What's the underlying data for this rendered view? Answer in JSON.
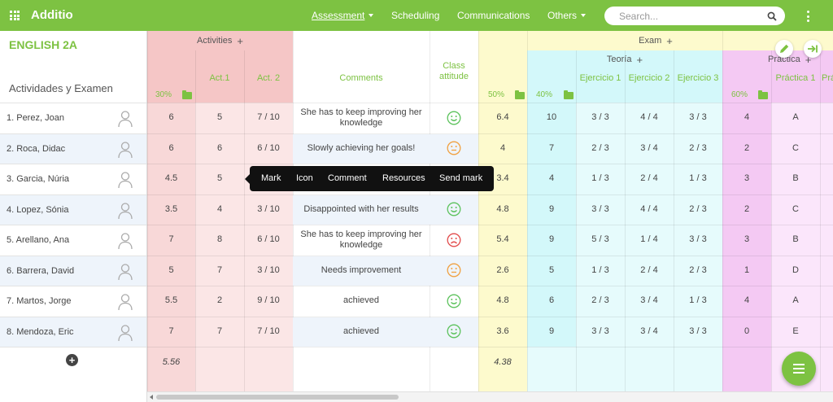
{
  "app": {
    "brand": "Additio"
  },
  "nav": {
    "items": [
      "Assessment",
      "Scheduling",
      "Communications",
      "Others"
    ],
    "search_placeholder": "Search..."
  },
  "colors": {
    "brand": "#7dc242",
    "activities": "#f5c6c6",
    "exam": "#fdfacd",
    "teoria": "#d3f8fa",
    "practica": "#f4c9f3",
    "face_happy": "#5cc25c",
    "face_neutral": "#f0a040",
    "face_sad": "#e24a4a"
  },
  "class": {
    "name": "ENGLISH 2A",
    "left_title": "Actividades y Examen"
  },
  "columns": {
    "activities": {
      "title": "Activities",
      "pct": "30%",
      "act1": "Act.1",
      "act2": "Act. 2"
    },
    "comments": "Comments",
    "attitude": "Class attitude",
    "exam": {
      "title": "Exam",
      "pct": "50%"
    },
    "teoria": {
      "title": "Teoría",
      "pct": "40%",
      "ej1": "Ejercicio 1",
      "ej2": "Ejercicio 2",
      "ej3": "Ejercicio 3"
    },
    "practica": {
      "title": "Práctica",
      "pct": "60%",
      "p1": "Práctica 1",
      "p2": "Prá"
    }
  },
  "students": [
    {
      "name": "1. Perez, Joan",
      "act_avg": "6",
      "act1": "5",
      "act2": "7 / 10",
      "comment": "She has to keep improving her knowledge",
      "face": "happy",
      "exam": "6.4",
      "teoria": "10",
      "ej1": "3 / 3",
      "ej2": "4 / 4",
      "ej3": "3 / 3",
      "practica": "4",
      "p1": "A"
    },
    {
      "name": "2. Roca, Didac",
      "act_avg": "6",
      "act1": "6",
      "act2": "6 / 10",
      "comment": "Slowly achieving her goals!",
      "face": "neutral",
      "exam": "4",
      "teoria": "7",
      "ej1": "2 / 3",
      "ej2": "3 / 4",
      "ej3": "2 / 3",
      "practica": "2",
      "p1": "C"
    },
    {
      "name": "3. Garcia, Núria",
      "act_avg": "4.5",
      "act1": "5",
      "act2": "",
      "comment": "",
      "face": "",
      "exam": "3.4",
      "teoria": "4",
      "ej1": "1 / 3",
      "ej2": "2 / 4",
      "ej3": "1 / 3",
      "practica": "3",
      "p1": "B"
    },
    {
      "name": "4. Lopez, Sónia",
      "act_avg": "3.5",
      "act1": "4",
      "act2": "3 / 10",
      "comment": "Disappointed with her results",
      "face": "happy",
      "exam": "4.8",
      "teoria": "9",
      "ej1": "3 / 3",
      "ej2": "4 / 4",
      "ej3": "2 / 3",
      "practica": "2",
      "p1": "C"
    },
    {
      "name": "5. Arellano, Ana",
      "act_avg": "7",
      "act1": "8",
      "act2": "6 / 10",
      "comment": "She has to keep improving her knowledge",
      "face": "sad",
      "exam": "5.4",
      "teoria": "9",
      "ej1": "5 / 3",
      "ej2": "1 / 4",
      "ej3": "3 / 3",
      "practica": "3",
      "p1": "B"
    },
    {
      "name": "6. Barrera, David",
      "act_avg": "5",
      "act1": "7",
      "act2": "3 / 10",
      "comment": "Needs improvement",
      "face": "neutral",
      "exam": "2.6",
      "teoria": "5",
      "ej1": "1 / 3",
      "ej2": "2 / 4",
      "ej3": "2 / 3",
      "practica": "1",
      "p1": "D"
    },
    {
      "name": "7. Martos, Jorge",
      "act_avg": "5.5",
      "act1": "2",
      "act2": "9 / 10",
      "comment": "achieved",
      "face": "happy",
      "exam": "4.8",
      "teoria": "6",
      "ej1": "2 / 3",
      "ej2": "3 / 4",
      "ej3": "1 / 3",
      "practica": "4",
      "p1": "A"
    },
    {
      "name": "8. Mendoza, Eric",
      "act_avg": "7",
      "act1": "7",
      "act2": "7 / 10",
      "comment": "achieved",
      "face": "happy",
      "exam": "3.6",
      "teoria": "9",
      "ej1": "3 / 3",
      "ej2": "3 / 4",
      "ej3": "3 / 3",
      "practica": "0",
      "p1": "E"
    }
  ],
  "averages": {
    "activities": "5.56",
    "exam": "4.38"
  },
  "context_menu": {
    "items": [
      "Mark",
      "Icon",
      "Comment",
      "Resources",
      "Send mark"
    ]
  }
}
